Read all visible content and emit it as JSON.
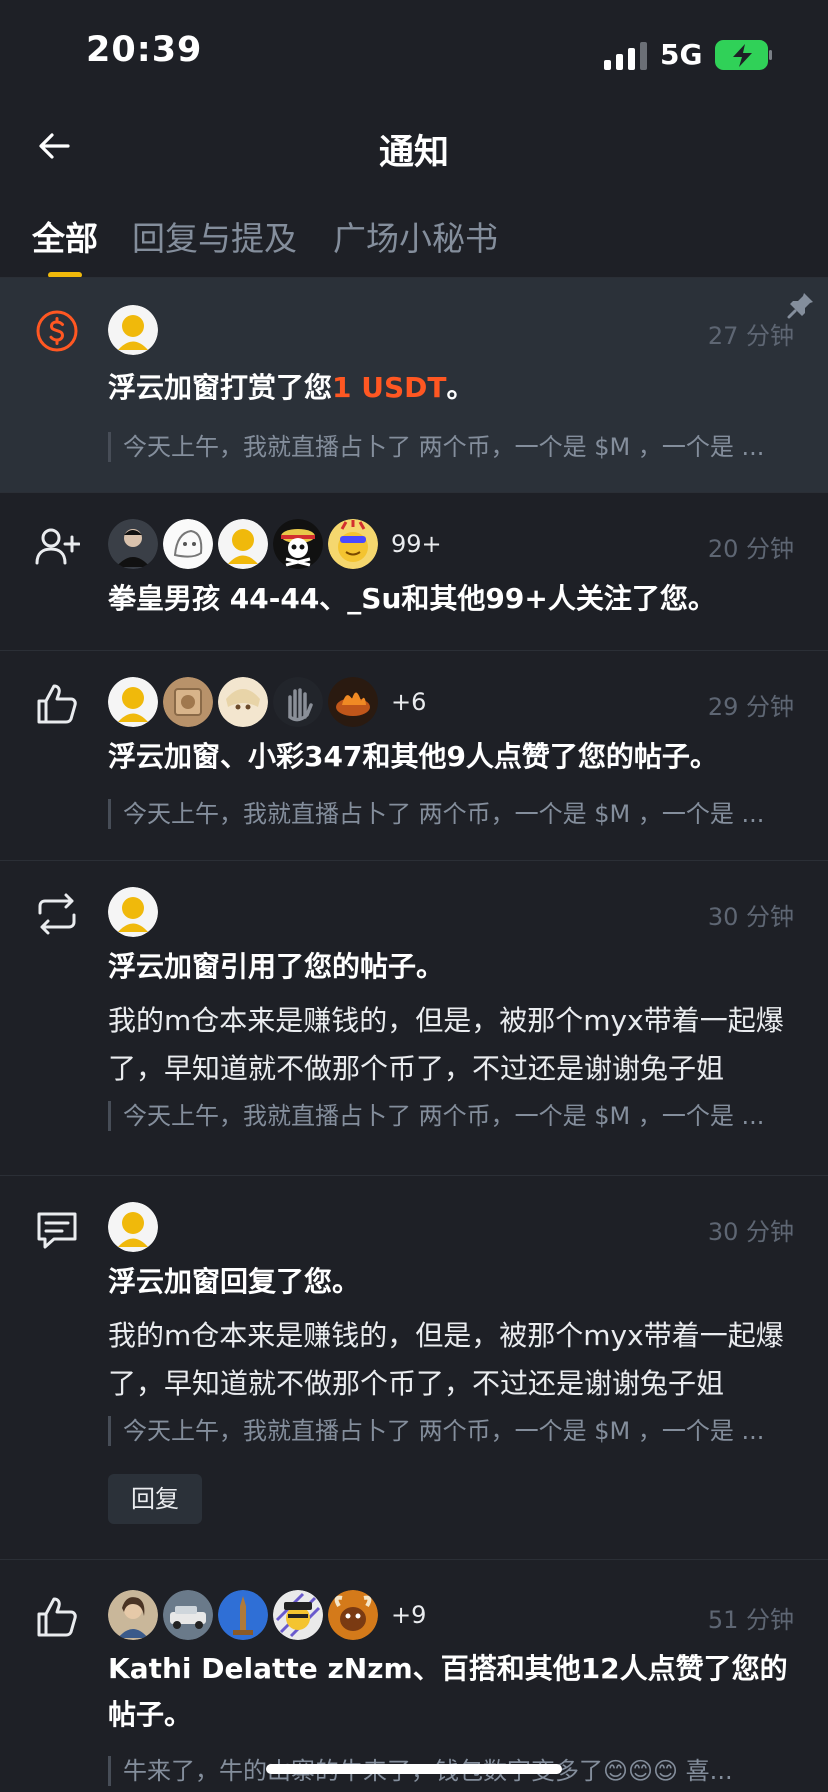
{
  "status_bar": {
    "time": "20:39",
    "network": "5G"
  },
  "header": {
    "title": "通知"
  },
  "tabs": [
    {
      "label": "全部",
      "active": true
    },
    {
      "label": "回复与提及",
      "active": false
    },
    {
      "label": "广场小秘书",
      "active": false
    }
  ],
  "colors": {
    "accent": "#f0b90b",
    "tip_orange": "#ff5722",
    "background": "#1e2026",
    "highlight": "#2b3139"
  },
  "notifications": [
    {
      "type_icon": "dollar-circle-icon",
      "pinned": true,
      "time_ago": "27 分钟",
      "headline_prefix": "浮云加窗打赏了您",
      "headline_accent": "1 USDT",
      "headline_suffix": "。",
      "quote": "今天上午，我就直播占卜了 两个币，一个是 $M ，一个是 ..."
    },
    {
      "type_icon": "user-plus-icon",
      "time_ago": "20 分钟",
      "avatar_more": "99+",
      "headline": "拳皇男孩 44-44、_Su和其他99+人关注了您。"
    },
    {
      "type_icon": "thumbs-up-icon",
      "time_ago": "29 分钟",
      "avatar_more": "+6",
      "headline": "浮云加窗、小彩347和其他9人点赞了您的帖子。",
      "quote": "今天上午，我就直播占卜了 两个币，一个是 $M ，一个是 ..."
    },
    {
      "type_icon": "repost-icon",
      "time_ago": "30 分钟",
      "headline": "浮云加窗引用了您的帖子。",
      "body": "我的m仓本来是赚钱的，但是，被那个myx带着一起爆了，早知道就不做那个币了，不过还是谢谢兔子姐",
      "quote": "今天上午，我就直播占卜了 两个币，一个是 $M ，一个是 ..."
    },
    {
      "type_icon": "comment-icon",
      "time_ago": "30 分钟",
      "headline": "浮云加窗回复了您。",
      "body": "我的m仓本来是赚钱的，但是，被那个myx带着一起爆了，早知道就不做那个币了，不过还是谢谢兔子姐",
      "quote": "今天上午，我就直播占卜了 两个币，一个是 $M ，一个是 ...",
      "reply_label": "回复"
    },
    {
      "type_icon": "thumbs-up-icon",
      "time_ago": "51 分钟",
      "avatar_more": "+9",
      "headline": "Kathi Delatte zNzm、百搭和其他12人点赞了您的帖子。",
      "quote": "牛来了，牛的山寨的牛来了，钱包数字变多了😊😊😊 喜..."
    }
  ]
}
